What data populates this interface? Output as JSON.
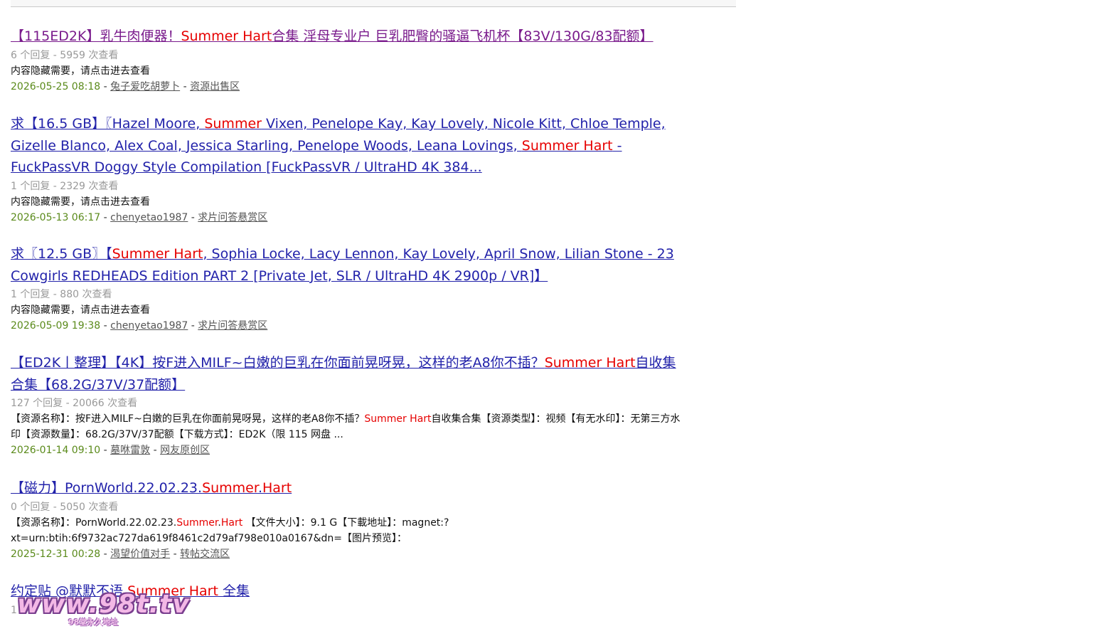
{
  "watermark": {
    "text": "www.98t.tv",
    "sub": "98堂永久地址"
  },
  "results": [
    {
      "title": [
        {
          "t": "【115ED2K】乳牛肉便器！"
        },
        {
          "t": "Summer Hart",
          "hl": true
        },
        {
          "t": "合集 淫母专业户 巨乳肥臀的骚逼飞机杯【83V/130G/83配额】"
        }
      ],
      "visited": true,
      "stats": "6 个回复 - 5959 次查看",
      "desc": [
        {
          "t": "内容隐藏需要，请点击进去查看"
        }
      ],
      "date": "2026-05-25 08:18",
      "author": "兔子爱吃胡萝卜",
      "forum": "资源出售区"
    },
    {
      "title": [
        {
          "t": "求【16.5 GB】〖Hazel Moore, "
        },
        {
          "t": "Summer",
          "hl": true
        },
        {
          "t": " Vixen, Penelope Kay, Kay Lovely, Nicole Kitt, Chloe Temple, Gizelle Blanco, Alex Coal, Jessica Starling, Penelope Woods, Leana Lovings, "
        },
        {
          "t": "Summer Hart",
          "hl": true
        },
        {
          "t": " - FuckPassVR Doggy Style Compilation [FuckPassVR / UltraHD 4K 384..."
        }
      ],
      "visited": false,
      "stats": "1 个回复 - 2329 次查看",
      "desc": [
        {
          "t": "内容隐藏需要，请点击进去查看"
        }
      ],
      "date": "2026-05-13 06:17",
      "author": "chenyetao1987",
      "forum": "求片问答悬赏区"
    },
    {
      "title": [
        {
          "t": "求〖12.5 GB〗【"
        },
        {
          "t": "Summer Hart",
          "hl": true
        },
        {
          "t": ", Sophia Locke, Lacy Lennon, Kay Lovely, April Snow, Lilian Stone - 23 Cowgirls REDHEADS Edition PART 2 [Private Jet, SLR / UltraHD 4K 2900p / VR]】"
        }
      ],
      "visited": false,
      "stats": "1 个回复 - 880 次查看",
      "desc": [
        {
          "t": "内容隐藏需要，请点击进去查看"
        }
      ],
      "date": "2026-05-09 19:38",
      "author": "chenyetao1987",
      "forum": "求片问答悬赏区"
    },
    {
      "title": [
        {
          "t": "【ED2K丨整理】【4K】按F进入MILF~白嫩的巨乳在你面前晃呀晃，这样的老A8你不插？"
        },
        {
          "t": "Summer Hart",
          "hl": true
        },
        {
          "t": "自收集合集【68.2G/37V/37配额】"
        }
      ],
      "visited": false,
      "stats": "127 个回复 - 20066 次查看",
      "desc": [
        {
          "t": "【资源名称】：按F进入MILF~白嫩的巨乳在你面前晃呀晃，这样的老A8你不插？"
        },
        {
          "t": "Summer Hart",
          "hl": true
        },
        {
          "t": "自收集合集【资源类型】：视频【有无水印】：无第三方水印【资源数量】：68.2G/37V/37配额【下载方式】：ED2K（限 115 网盘 ..."
        }
      ],
      "date": "2026-01-14 09:10",
      "author": "墓咻雷敦",
      "forum": "网友原创区"
    },
    {
      "title": [
        {
          "t": "【磁力】PornWorld.22.02.23."
        },
        {
          "t": "Summer",
          "hl": true
        },
        {
          "t": "."
        },
        {
          "t": "Hart",
          "hl": true
        }
      ],
      "visited": false,
      "stats": "0 个回复 - 5050 次查看",
      "desc": [
        {
          "t": "【资源名称】：PornWorld.22.02.23."
        },
        {
          "t": "Summer",
          "hl": true
        },
        {
          "t": "."
        },
        {
          "t": "Hart",
          "hl": true
        },
        {
          "t": " 【文件大小】：9.1 G【下載地址】：magnet:?xt=urn:btih:6f9732ac727da619f8461c2d79af798e010a0167&dn=【图片预览】："
        }
      ],
      "date": "2025-12-31 00:28",
      "author": "渴望价值对手",
      "forum": "转帖交流区"
    },
    {
      "title": [
        {
          "t": "约定贴 @默默不语 "
        },
        {
          "t": "Summer Hart",
          "hl": true
        },
        {
          "t": " 全集"
        }
      ],
      "visited": false,
      "stats": "1",
      "desc": [],
      "date": "",
      "author": "",
      "forum": ""
    }
  ]
}
